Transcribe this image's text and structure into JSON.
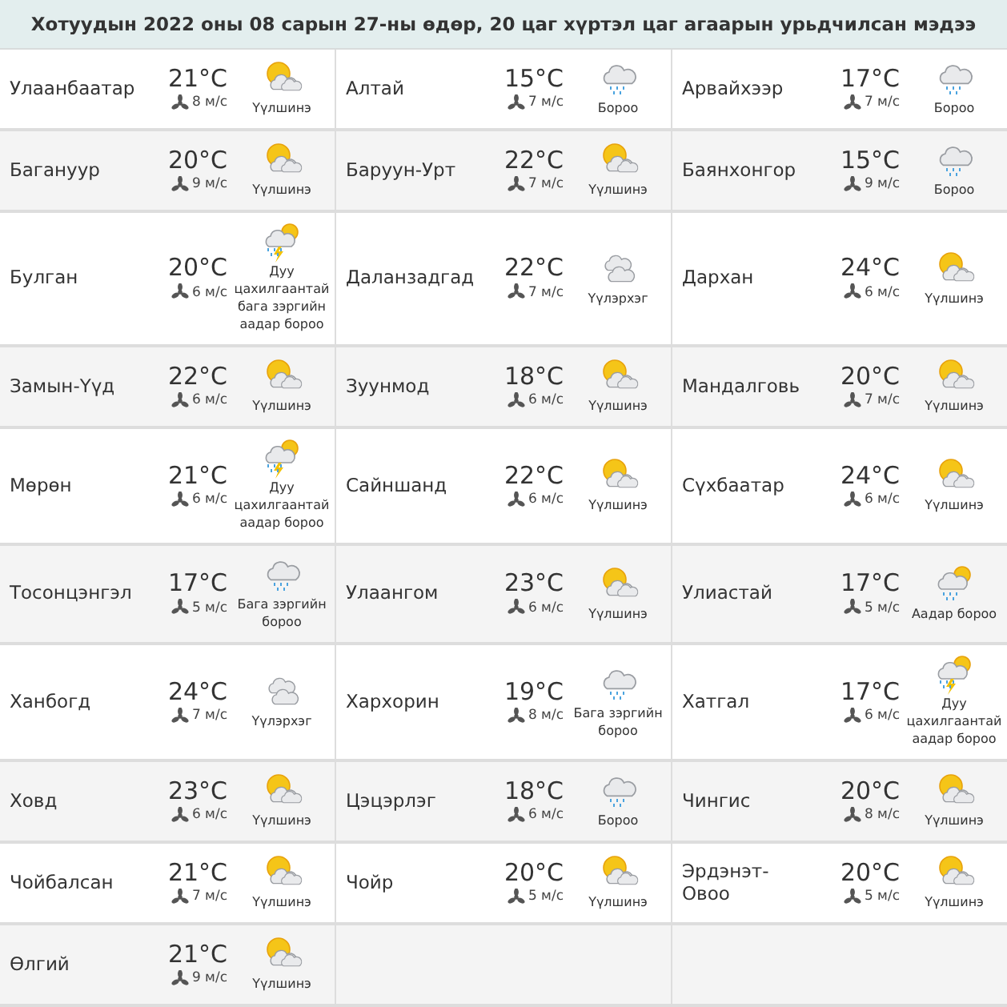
{
  "title": "Хотуудын 2022 оны 08 сарын 27-ны өдөр, 20 цаг хүртэл цаг агаарын урьдчилсан мэдээ",
  "cities": [
    {
      "name": "Улаанбаатар",
      "temp": "21°C",
      "wind": "8 м/с",
      "kind": "sun-cloud",
      "desc": "Үүлшинэ"
    },
    {
      "name": "Алтай",
      "temp": "15°C",
      "wind": "7 м/с",
      "kind": "rain",
      "desc": "Бороо"
    },
    {
      "name": "Арвайхээр",
      "temp": "17°C",
      "wind": "7 м/с",
      "kind": "rain",
      "desc": "Бороо"
    },
    {
      "name": "Багануур",
      "temp": "20°C",
      "wind": "9 м/с",
      "kind": "sun-cloud",
      "desc": "Үүлшинэ"
    },
    {
      "name": "Баруун-Урт",
      "temp": "22°C",
      "wind": "7 м/с",
      "kind": "sun-cloud",
      "desc": "Үүлшинэ"
    },
    {
      "name": "Баянхонгор",
      "temp": "15°C",
      "wind": "9 м/с",
      "kind": "rain",
      "desc": "Бороо"
    },
    {
      "name": "Булган",
      "temp": "20°C",
      "wind": "6 м/с",
      "kind": "storm",
      "desc": "Дуу цахилгаантай бага зэргийн аадар бороо"
    },
    {
      "name": "Даланзадгад",
      "temp": "22°C",
      "wind": "7 м/с",
      "kind": "clouds",
      "desc": "Үүлэрхэг"
    },
    {
      "name": "Дархан",
      "temp": "24°C",
      "wind": "6 м/с",
      "kind": "sun-cloud",
      "desc": "Үүлшинэ"
    },
    {
      "name": "Замын-Үүд",
      "temp": "22°C",
      "wind": "6 м/с",
      "kind": "sun-cloud",
      "desc": "Үүлшинэ"
    },
    {
      "name": "Зуунмод",
      "temp": "18°C",
      "wind": "6 м/с",
      "kind": "sun-cloud",
      "desc": "Үүлшинэ"
    },
    {
      "name": "Мандалговь",
      "temp": "20°C",
      "wind": "7 м/с",
      "kind": "sun-cloud",
      "desc": "Үүлшинэ"
    },
    {
      "name": "Мөрөн",
      "temp": "21°C",
      "wind": "6 м/с",
      "kind": "storm",
      "desc": "Дуу цахилгаантай аадар бороо"
    },
    {
      "name": "Сайншанд",
      "temp": "22°C",
      "wind": "6 м/с",
      "kind": "sun-cloud",
      "desc": "Үүлшинэ"
    },
    {
      "name": "Сүхбаатар",
      "temp": "24°C",
      "wind": "6 м/с",
      "kind": "sun-cloud",
      "desc": "Үүлшинэ"
    },
    {
      "name": "Тосонцэнгэл",
      "temp": "17°C",
      "wind": "5 м/с",
      "kind": "rain",
      "desc": "Бага зэргийн бороо"
    },
    {
      "name": "Улаангом",
      "temp": "23°C",
      "wind": "6 м/с",
      "kind": "sun-cloud",
      "desc": "Үүлшинэ"
    },
    {
      "name": "Улиастай",
      "temp": "17°C",
      "wind": "5 м/с",
      "kind": "sun-rain",
      "desc": "Аадар бороо"
    },
    {
      "name": "Ханбогд",
      "temp": "24°C",
      "wind": "7 м/с",
      "kind": "clouds",
      "desc": "Үүлэрхэг"
    },
    {
      "name": "Хархорин",
      "temp": "19°C",
      "wind": "8 м/с",
      "kind": "rain",
      "desc": "Бага зэргийн бороо"
    },
    {
      "name": "Хатгал",
      "temp": "17°C",
      "wind": "6 м/с",
      "kind": "storm",
      "desc": "Дуу цахилгаантай аадар бороо"
    },
    {
      "name": "Ховд",
      "temp": "23°C",
      "wind": "6 м/с",
      "kind": "sun-cloud",
      "desc": "Үүлшинэ"
    },
    {
      "name": "Цэцэрлэг",
      "temp": "18°C",
      "wind": "6 м/с",
      "kind": "rain",
      "desc": "Бороо"
    },
    {
      "name": "Чингис",
      "temp": "20°C",
      "wind": "8 м/с",
      "kind": "sun-cloud",
      "desc": "Үүлшинэ"
    },
    {
      "name": "Чойбалсан",
      "temp": "21°C",
      "wind": "7 м/с",
      "kind": "sun-cloud",
      "desc": "Үүлшинэ"
    },
    {
      "name": "Чойр",
      "temp": "20°C",
      "wind": "5 м/с",
      "kind": "sun-cloud",
      "desc": "Үүлшинэ"
    },
    {
      "name": "Эрдэнэт-Овоо",
      "temp": "20°C",
      "wind": "5 м/с",
      "kind": "sun-cloud",
      "desc": "Үүлшинэ"
    },
    {
      "name": "Өлгий",
      "temp": "21°C",
      "wind": "9 м/с",
      "kind": "sun-cloud",
      "desc": "Үүлшинэ"
    }
  ]
}
